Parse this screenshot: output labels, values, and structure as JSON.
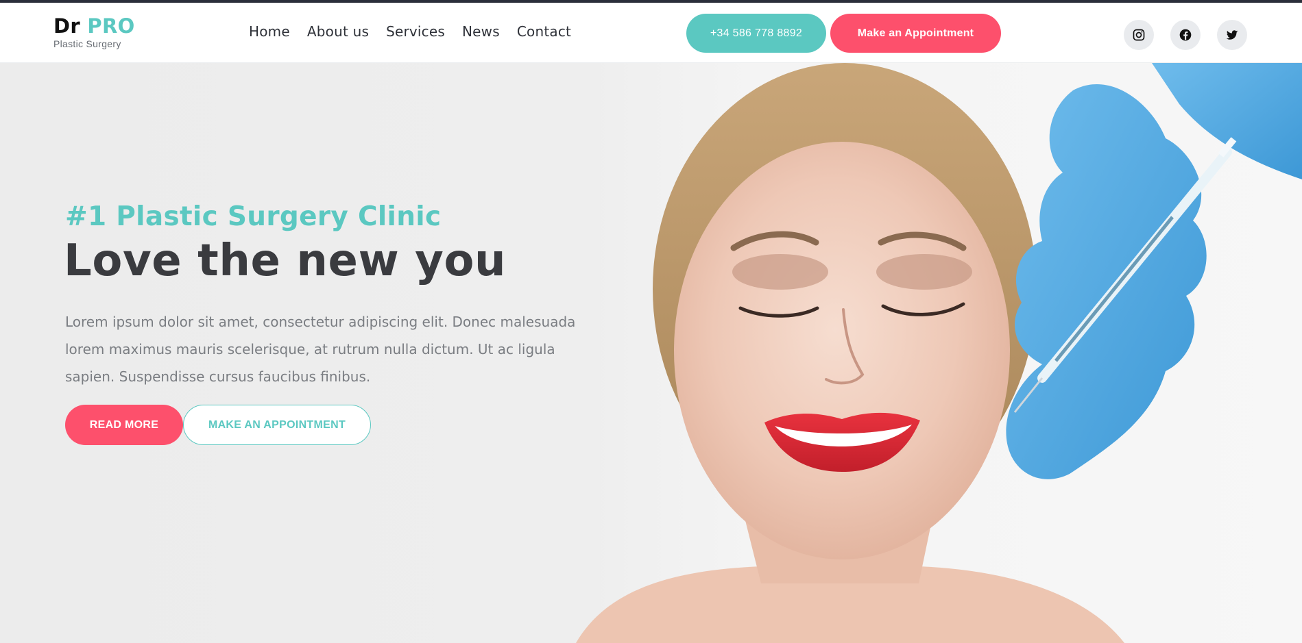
{
  "brand": {
    "name_part1": "Dr",
    "name_part2": "PRO",
    "tagline": "Plastic Surgery"
  },
  "nav": {
    "items": [
      "Home",
      "About us",
      "Services",
      "News",
      "Contact"
    ]
  },
  "header_actions": {
    "phone": "+34 586 778 8892",
    "appointment": "Make an Appointment"
  },
  "social": [
    "instagram-icon",
    "facebook-icon",
    "twitter-icon"
  ],
  "hero": {
    "eyebrow": "#1 Plastic Surgery Clinic",
    "headline": "Love the new you",
    "body": "Lorem ipsum dolor sit amet, consectetur adipiscing elit. Donec malesuada lorem maximus mauris scelerisque, at rutrum nulla dictum. Ut ac ligula sapien. Suspendisse cursus faucibus finibus.",
    "read_more": "READ MORE",
    "make_appointment": "MAKE AN APPOINTMENT"
  },
  "colors": {
    "accent_teal": "#5bc8c1",
    "accent_pink": "#fd506c",
    "text_dark": "#3a3b3f",
    "glove_blue": "#4aa6e0"
  }
}
